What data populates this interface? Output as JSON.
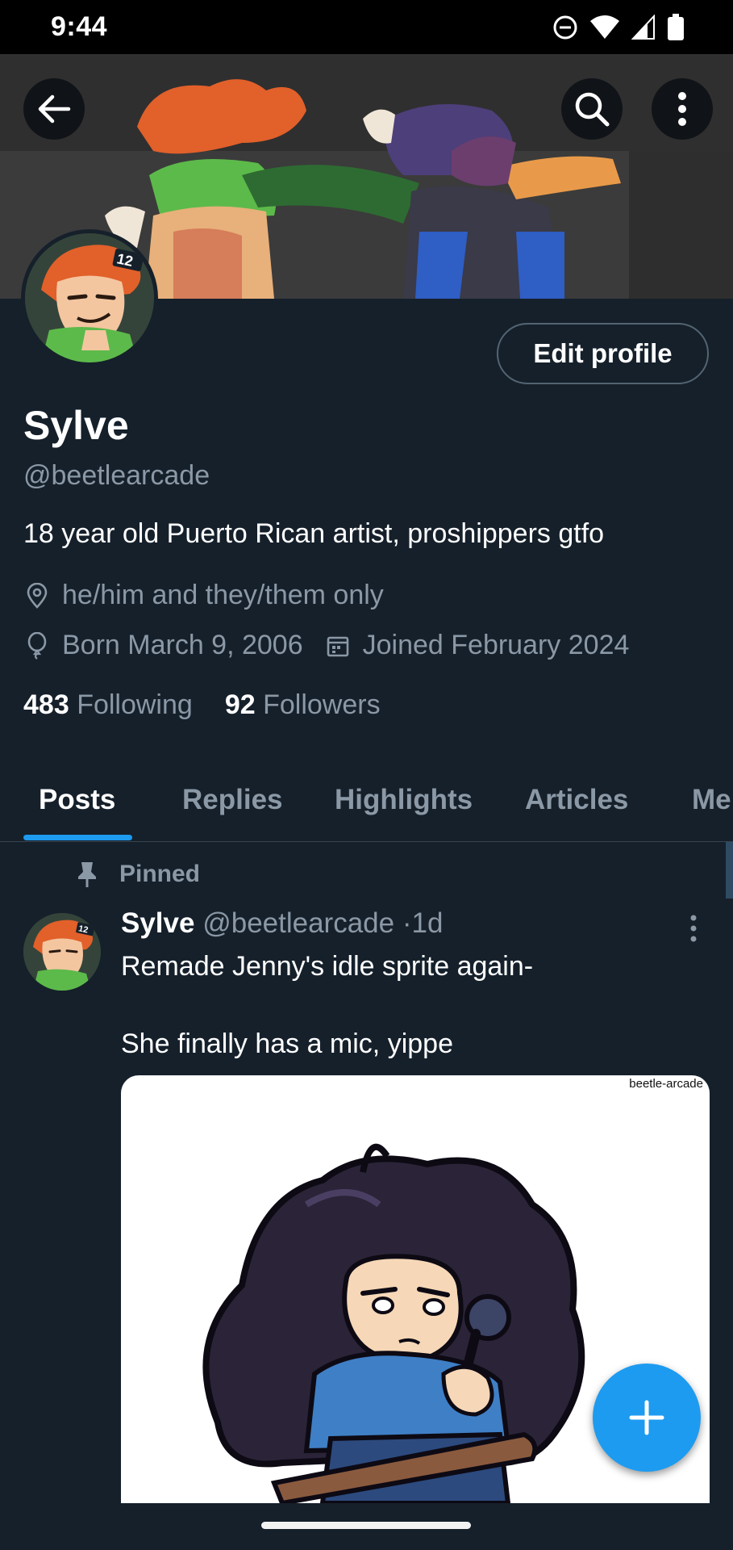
{
  "status_bar": {
    "time": "9:44",
    "icons": [
      "do-not-disturb-icon",
      "wifi-icon",
      "cell-signal-icon",
      "battery-icon"
    ]
  },
  "header": {
    "back_icon": "arrow-left-icon",
    "search_icon": "search-icon",
    "more_icon": "more-vertical-icon"
  },
  "profile": {
    "display_name": "Sylve",
    "handle": "@beetlearcade",
    "edit_button_label": "Edit profile",
    "bio": "18 year old Puerto Rican artist, proshippers gtfo",
    "location": "he/him and they/them only",
    "birthday": "Born March 9, 2006",
    "joined": "Joined February 2024",
    "following_count": "483",
    "following_label": "Following",
    "followers_count": "92",
    "followers_label": "Followers",
    "avatar_badge": "12"
  },
  "tabs": [
    {
      "label": "Posts",
      "active": true
    },
    {
      "label": "Replies",
      "active": false
    },
    {
      "label": "Highlights",
      "active": false
    },
    {
      "label": "Articles",
      "active": false
    },
    {
      "label": "Me",
      "active": false
    }
  ],
  "pinned_post": {
    "pinned_label": "Pinned",
    "author_name": "Sylve",
    "author_handle": "@beetlearcade",
    "separator": "·",
    "time": "1d",
    "text_line1": "Remade Jenny's idle sprite again-",
    "text_line2": "She finally has a mic, yippe",
    "image_watermark": "beetle-arcade"
  },
  "fab": {
    "icon": "plus-icon"
  },
  "colors": {
    "background": "#15202b",
    "accent": "#1d9bf0",
    "secondary_text": "#8b98a5",
    "border": "#536471"
  }
}
